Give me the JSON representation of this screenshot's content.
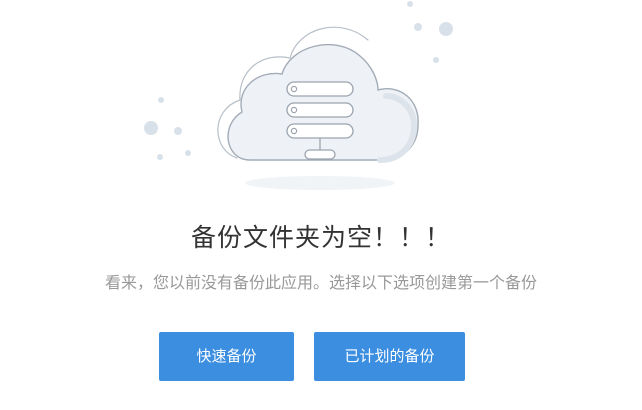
{
  "empty_state": {
    "illustration_icon": "cloud-server-icon",
    "title": "备份文件夹为空！！！",
    "subtitle": "看来，您以前没有备份此应用。选择以下选项创建第一个备份"
  },
  "actions": {
    "quick_backup_label": "快速备份",
    "scheduled_backup_label": "已计划的备份"
  },
  "colors": {
    "button_background": "#3b8ee0",
    "button_text": "#ffffff",
    "title_text": "#333333",
    "subtitle_text": "#999999",
    "cloud_fill": "#eef2f6",
    "cloud_stroke": "#a3acb7",
    "dots": "#d8e1ea"
  }
}
